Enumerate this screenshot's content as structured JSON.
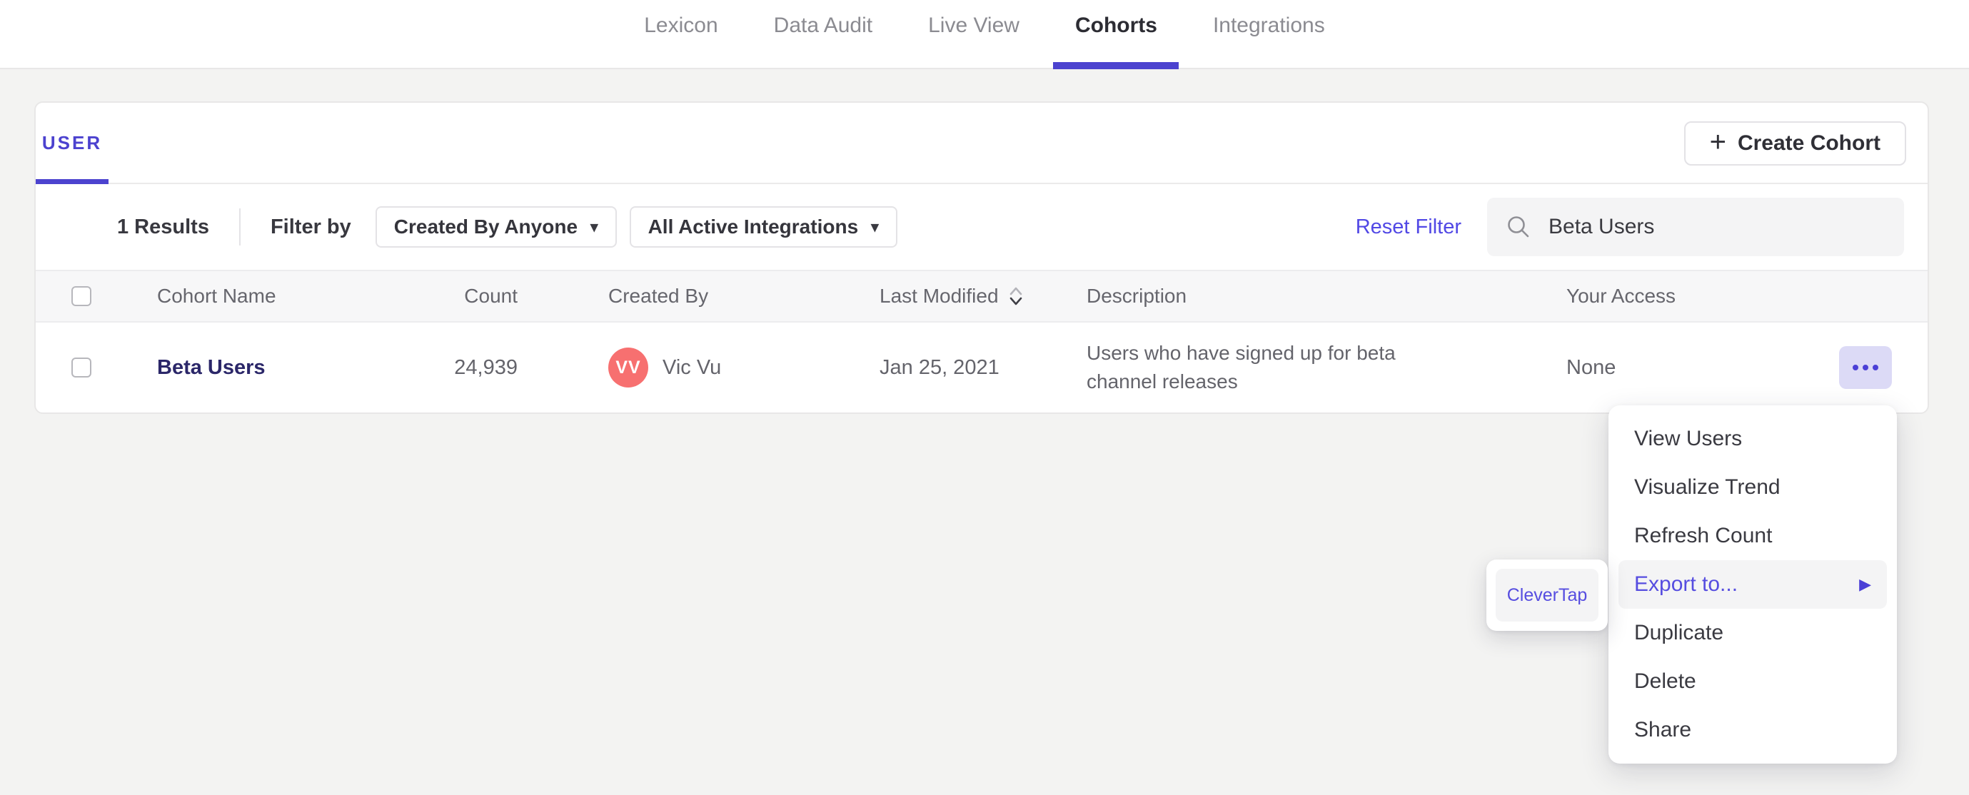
{
  "nav": {
    "items": [
      {
        "label": "Lexicon",
        "active": false
      },
      {
        "label": "Data Audit",
        "active": false
      },
      {
        "label": "Live View",
        "active": false
      },
      {
        "label": "Cohorts",
        "active": true
      },
      {
        "label": "Integrations",
        "active": false
      }
    ]
  },
  "cohorts": {
    "tab_label": "USER",
    "create_button_label": "Create Cohort",
    "filters": {
      "results_text": "1 Results",
      "filter_by_label": "Filter by",
      "created_by_value": "Created By Anyone",
      "integrations_value": "All Active Integrations",
      "reset_label": "Reset Filter",
      "search_value": "Beta Users"
    },
    "table": {
      "select_all_checked": false,
      "headers": {
        "name": "Cohort Name",
        "count": "Count",
        "created_by": "Created By",
        "last_modified": "Last Modified",
        "description": "Description",
        "access": "Your Access"
      },
      "rows": [
        {
          "checked": false,
          "name": "Beta Users",
          "count": "24,939",
          "avatar_initials": "VV",
          "created_by": "Vic Vu",
          "last_modified": "Jan 25, 2021",
          "description": "Users who have signed up for beta channel releases",
          "access": "None"
        }
      ]
    }
  },
  "context_menu": {
    "items": [
      {
        "label": "View Users",
        "highlighted": false
      },
      {
        "label": "Visualize Trend",
        "highlighted": false
      },
      {
        "label": "Refresh Count",
        "highlighted": false
      },
      {
        "label": "Export to...",
        "highlighted": true,
        "has_submenu": true
      },
      {
        "label": "Duplicate",
        "highlighted": false
      },
      {
        "label": "Delete",
        "highlighted": false
      },
      {
        "label": "Share",
        "highlighted": false
      }
    ],
    "submenu_items": [
      {
        "label": "CleverTap"
      }
    ]
  },
  "icons": {
    "plus": "+",
    "caret_down": "▾",
    "submenu_arrow": "▶"
  },
  "colors": {
    "accent": "#4c43cf",
    "link_purple": "#5148e5",
    "cohort_link": "#2b2769",
    "avatar": "#f77070",
    "more_button_bg": "#dcdaf6"
  }
}
